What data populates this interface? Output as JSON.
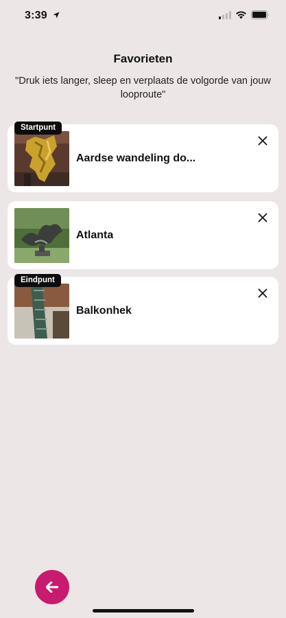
{
  "status": {
    "time": "3:39"
  },
  "header": {
    "title": "Favorieten",
    "subtitle": "\"Druk iets langer, sleep en verplaats de volgorde van jouw looproute\""
  },
  "favorites": [
    {
      "label": "Aardse wandeling do...",
      "badge": "Startpunt"
    },
    {
      "label": "Atlanta",
      "badge": ""
    },
    {
      "label": "Balkonhek",
      "badge": "Eindpunt"
    }
  ],
  "colors": {
    "background": "#ece6e6",
    "card": "#ffffff",
    "accent": "#c81a6e",
    "badge": "#0c0c0c"
  },
  "icons": {
    "location": "location-arrow-icon",
    "signal": "cellular-signal-icon",
    "wifi": "wifi-icon",
    "battery": "battery-icon",
    "close": "close-icon",
    "back": "arrow-left-icon"
  }
}
